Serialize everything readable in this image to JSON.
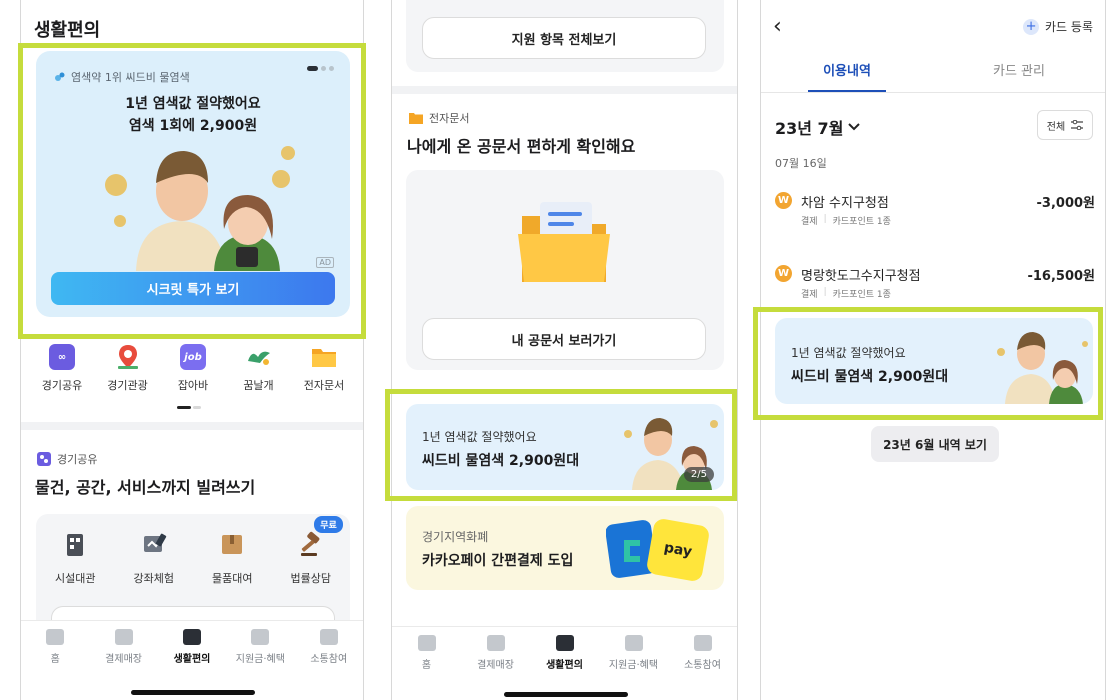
{
  "phone1": {
    "header_title": "생활편의",
    "banner": {
      "brand": "염색약 1위 씨드비 물염색",
      "headline": "1년 염색값 절약했어요",
      "subline": "염색 1회에 2,900원",
      "ad_label": "AD",
      "cta": "시크릿 특가 보기"
    },
    "quick_menu": [
      {
        "label": "경기공유",
        "icon": "share-icon",
        "color": "#6b5ce0"
      },
      {
        "label": "경기관광",
        "icon": "map-pin-icon",
        "color": "#e84c3d"
      },
      {
        "label": "잡아바",
        "icon": "job-icon",
        "color": "#7b6ef0"
      },
      {
        "label": "꿈날개",
        "icon": "wing-icon",
        "color": "#3aa06a"
      },
      {
        "label": "전자문서",
        "icon": "folder-icon",
        "color": "#f5a524"
      }
    ],
    "section": {
      "label": "경기공유",
      "title": "물건, 공간, 서비스까지 빌려쓰기",
      "services": [
        {
          "label": "시설대관",
          "icon": "building-icon"
        },
        {
          "label": "강좌체험",
          "icon": "class-icon"
        },
        {
          "label": "물품대여",
          "icon": "box-icon"
        },
        {
          "label": "법률상담",
          "icon": "gavel-icon",
          "badge": "무료"
        }
      ]
    },
    "tabbar": [
      {
        "label": "홈"
      },
      {
        "label": "결제매장"
      },
      {
        "label": "생활편의"
      },
      {
        "label": "지원금·혜택"
      },
      {
        "label": "소통참여"
      }
    ]
  },
  "phone2": {
    "top_button": "지원 항목 전체보기",
    "doc_label": "전자문서",
    "doc_title": "나에게 온 공문서 편하게 확인해요",
    "doc_button": "내 공문서 보러가기",
    "promo1": {
      "line1": "1년 염색값 절약했어요",
      "line2": "씨드비 물염색 2,900원대",
      "page": "2/5"
    },
    "promo2": {
      "line1": "경기지역화폐",
      "line2": "카카오페이 간편결제 도입",
      "pay_label": "pay"
    },
    "tabbar": [
      {
        "label": "홈"
      },
      {
        "label": "결제매장"
      },
      {
        "label": "생활편의"
      },
      {
        "label": "지원금·혜택"
      },
      {
        "label": "소통참여"
      }
    ]
  },
  "phone3": {
    "back": "‹",
    "card_register": "카드 등록",
    "tabs": [
      "이용내역",
      "카드 관리"
    ],
    "month": "23년 7월",
    "filter": "전체",
    "date": "07월 16일",
    "transactions": [
      {
        "merchant": "차암 수지구청점",
        "amount": "-3,000원",
        "type": "결제",
        "method": "카드포인트 1종"
      },
      {
        "merchant": "명랑핫도그수지구청점",
        "amount": "-16,500원",
        "type": "결제",
        "method": "카드포인트 1종"
      }
    ],
    "promo": {
      "line1": "1년 염색값 절약했어요",
      "line2": "씨드비 물염색 2,900원대"
    },
    "prev_button": "23년 6월 내역 보기"
  }
}
